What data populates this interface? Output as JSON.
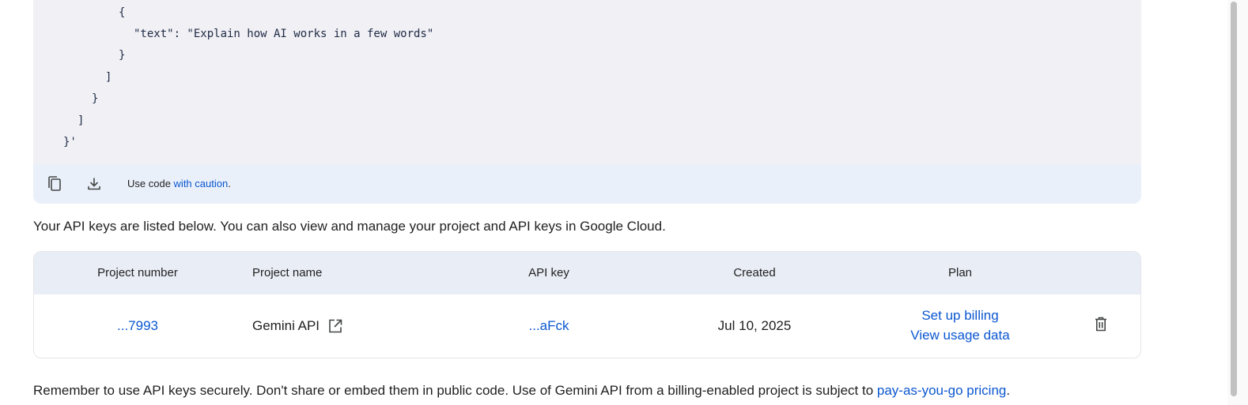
{
  "code_block": {
    "lines": [
      {
        "text": "{",
        "indent": 0
      },
      {
        "text": "\"text\": \"Explain how AI works in a few words\"",
        "indent": 1
      },
      {
        "text": "}",
        "indent": 2
      },
      {
        "text": "]",
        "indent": 3
      },
      {
        "text": "}",
        "indent": 4
      },
      {
        "text": "]",
        "indent": 5
      },
      {
        "text": "}'",
        "indent": 6
      }
    ],
    "copy_icon": "copy-icon",
    "download_icon": "download-icon",
    "caution_prefix": "Use code",
    "caution_link": "with caution",
    "caution_suffix": "."
  },
  "intro_text": "Your API keys are listed below. You can also view and manage your project and API keys in Google Cloud.",
  "table": {
    "headers": {
      "project_number": "Project number",
      "project_name": "Project name",
      "api_key": "API key",
      "created": "Created",
      "plan": "Plan"
    },
    "row": {
      "project_number": "...7993",
      "project_name": "Gemini API",
      "api_key": "...aFck",
      "created": "Jul 10, 2025",
      "plan_link_1": "Set up billing",
      "plan_link_2": "View usage data",
      "open_icon": "open-external-icon",
      "delete_icon": "delete-icon"
    }
  },
  "footer": {
    "text": "Remember to use API keys securely. Don't share or embed them in public code. Use of Gemini API from a billing-enabled project is subject to ",
    "link": "pay-as-you-go pricing",
    "suffix": "."
  },
  "colors": {
    "link": "#0b57d0",
    "code_bg": "#f0f0f5",
    "code_footer_bg": "#eaf0fa",
    "table_header_bg": "#e9eef6"
  }
}
